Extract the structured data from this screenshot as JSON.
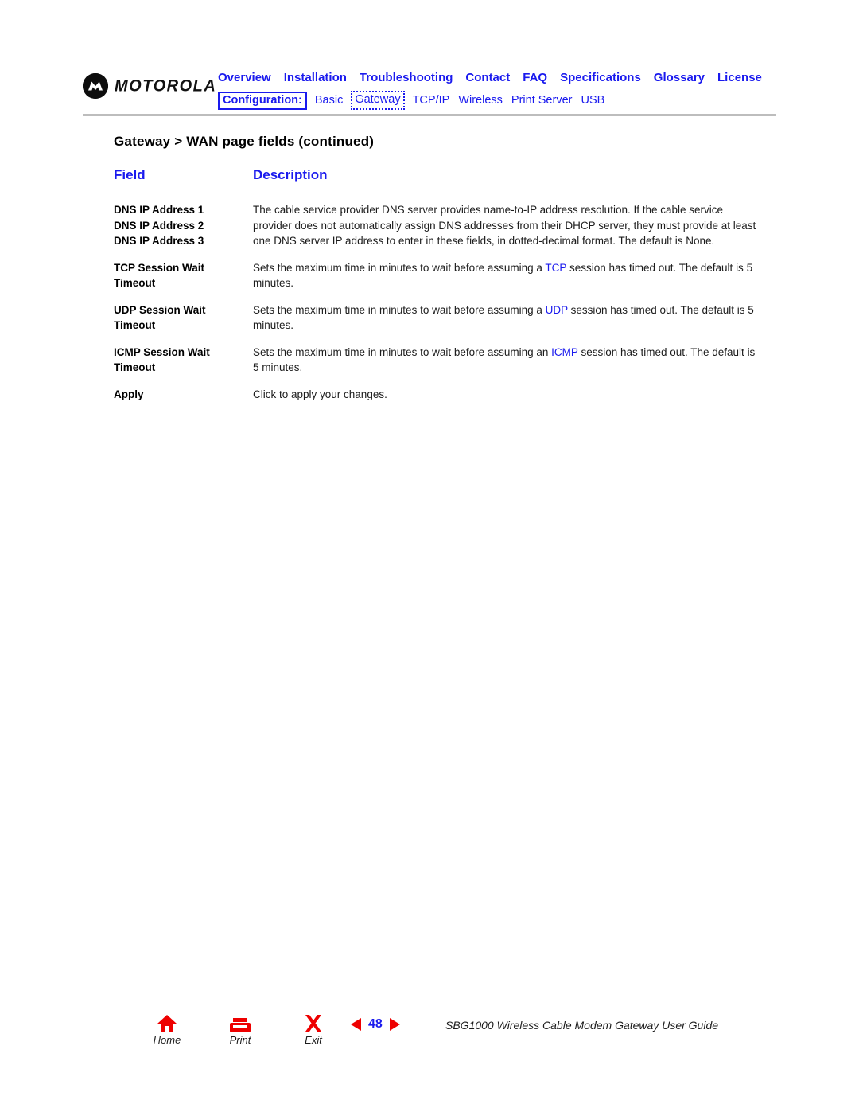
{
  "brand": {
    "logo_word": "MOTOROLA",
    "logo_icon": "motorola-batwing-icon"
  },
  "nav": {
    "primary": [
      "Overview",
      "Installation",
      "Troubleshooting",
      "Contact",
      "FAQ",
      "Specifications",
      "Glossary",
      "License"
    ],
    "config_label": "Configuration:",
    "secondary": [
      {
        "label": "Basic",
        "current": false
      },
      {
        "label": "Gateway",
        "current": true
      },
      {
        "label": "TCP/IP",
        "current": false
      },
      {
        "label": "Wireless",
        "current": false
      },
      {
        "label": "Print Server",
        "current": false
      },
      {
        "label": "USB",
        "current": false
      }
    ]
  },
  "page_title": "Gateway > WAN page fields (continued)",
  "table": {
    "headers": {
      "field": "Field",
      "description": "Description"
    },
    "rows": [
      {
        "field_lines": [
          "DNS IP Address 1",
          "DNS IP Address 2",
          "DNS IP Address 3"
        ],
        "description_parts": [
          {
            "text": "The cable service provider DNS server provides name-to-IP address resolution. If the cable service provider does not automatically assign DNS addresses from their DHCP server, they must provide at least one DNS server IP address to enter in these fields, in dotted-decimal format. The default is None.",
            "link": false
          }
        ]
      },
      {
        "field_lines": [
          "TCP Session Wait",
          "Timeout"
        ],
        "description_parts": [
          {
            "text": "Sets the maximum time in minutes to wait before assuming a ",
            "link": false
          },
          {
            "text": "TCP",
            "link": true
          },
          {
            "text": " session has timed out. The default is 5 minutes.",
            "link": false
          }
        ]
      },
      {
        "field_lines": [
          "UDP Session Wait",
          "Timeout"
        ],
        "description_parts": [
          {
            "text": "Sets the maximum time in minutes to wait before assuming a ",
            "link": false
          },
          {
            "text": "UDP",
            "link": true
          },
          {
            "text": " session has timed out. The default is 5 minutes.",
            "link": false
          }
        ]
      },
      {
        "field_lines": [
          "ICMP Session Wait",
          "Timeout"
        ],
        "description_parts": [
          {
            "text": "Sets the maximum time in minutes to wait before assuming an ",
            "link": false
          },
          {
            "text": "ICMP",
            "link": true
          },
          {
            "text": " session has timed out. The default is 5 minutes.",
            "link": false
          }
        ]
      },
      {
        "field_lines": [
          "Apply"
        ],
        "description_parts": [
          {
            "text": "Click to apply your changes.",
            "link": false
          }
        ]
      }
    ]
  },
  "footer": {
    "buttons": [
      {
        "label": "Home",
        "icon": "home-icon"
      },
      {
        "label": "Print",
        "icon": "printer-icon"
      },
      {
        "label": "Exit",
        "icon": "close-x-icon"
      }
    ],
    "prev_icon": "triangle-left-icon",
    "next_icon": "triangle-right-icon",
    "page_number": "48",
    "document_title": "SBG1000 Wireless Cable Modem Gateway User Guide"
  },
  "colors": {
    "link_blue": "#1a1aee",
    "accent_red": "#ee0000",
    "rule_gray": "#bdbdbd"
  }
}
